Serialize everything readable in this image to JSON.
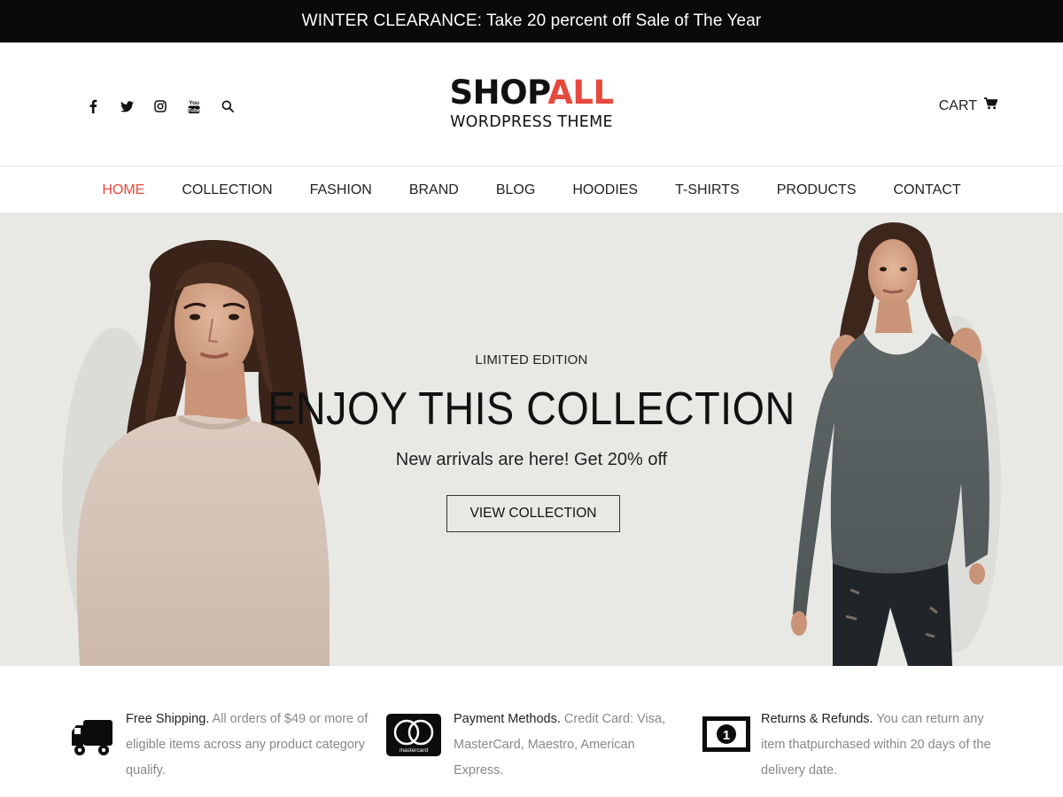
{
  "promo": {
    "text": "WINTER CLEARANCE: Take 20 percent off Sale of The Year"
  },
  "header": {
    "logo": {
      "main_a": "SHOP",
      "main_b": "ALL",
      "sub": "WORDPRESS THEME"
    },
    "social_icons": [
      "facebook-icon",
      "twitter-icon",
      "instagram-icon",
      "youtube-icon",
      "search-icon"
    ],
    "youtube_text": "You Tube",
    "cart_label": "CART"
  },
  "nav": {
    "items": [
      {
        "label": "HOME",
        "active": true
      },
      {
        "label": "COLLECTION"
      },
      {
        "label": "FASHION"
      },
      {
        "label": "BRAND"
      },
      {
        "label": "BLOG"
      },
      {
        "label": "HOODIES"
      },
      {
        "label": "T-SHIRTS"
      },
      {
        "label": "PRODUCTS"
      },
      {
        "label": "CONTACT"
      }
    ]
  },
  "hero": {
    "kicker": "LIMITED EDITION",
    "title": "ENJOY THIS COLLECTION",
    "subtitle": "New arrivals are here! Get 20% off",
    "button": "VIEW COLLECTION"
  },
  "features": [
    {
      "icon": "truck-icon",
      "title": "Free Shipping.",
      "lines": [
        " All orders of $49 or more of",
        "eligible items across any product category",
        "qualify."
      ]
    },
    {
      "icon": "mastercard-icon",
      "icon_text": "mastercard",
      "title": "Payment Methods.",
      "lines": [
        " Credit Card: Visa,",
        "MasterCard, Maestro, American",
        "Express."
      ]
    },
    {
      "icon": "money-bill-icon",
      "icon_text": "1",
      "title": "Returns & Refunds.",
      "lines": [
        " You can return any",
        "item thatpurchased within 20 days of the",
        "delivery date."
      ]
    }
  ],
  "colors": {
    "accent": "#e64a3c",
    "hero_bg": "#e8e9e5",
    "promo_bg": "#0a0a0a"
  }
}
